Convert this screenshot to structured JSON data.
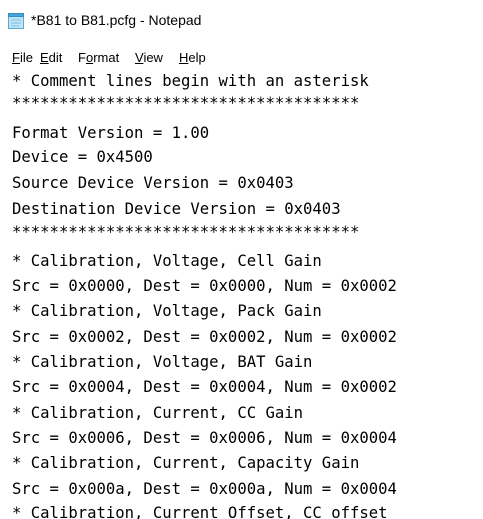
{
  "window": {
    "title": "*B81 to B81.pcfg - Notepad",
    "app_icon": "notepad-icon"
  },
  "menu": [
    {
      "accel": "F",
      "rest": "ile"
    },
    {
      "accel": "E",
      "rest": "dit"
    },
    {
      "pre": "F",
      "accel": "o",
      "rest": "rmat"
    },
    {
      "accel": "V",
      "rest": "iew"
    },
    {
      "accel": "H",
      "rest": "elp"
    }
  ],
  "editor": {
    "lines": [
      "* Comment lines begin with an asterisk",
      "*************************************",
      "Format Version = 1.00",
      "Device = 0x4500",
      "Source Device Version = 0x0403",
      "Destination Device Version = 0x0403",
      "*************************************",
      "* Calibration, Voltage, Cell Gain",
      "Src = 0x0000, Dest = 0x0000, Num = 0x0002",
      "* Calibration, Voltage, Pack Gain",
      "Src = 0x0002, Dest = 0x0002, Num = 0x0002",
      "* Calibration, Voltage, BAT Gain",
      "Src = 0x0004, Dest = 0x0004, Num = 0x0002",
      "* Calibration, Current, CC Gain",
      "Src = 0x0006, Dest = 0x0006, Num = 0x0004",
      "* Calibration, Current, Capacity Gain",
      "Src = 0x000a, Dest = 0x000a, Num = 0x0004",
      "* Calibration, Current Offset, CC offset"
    ]
  }
}
